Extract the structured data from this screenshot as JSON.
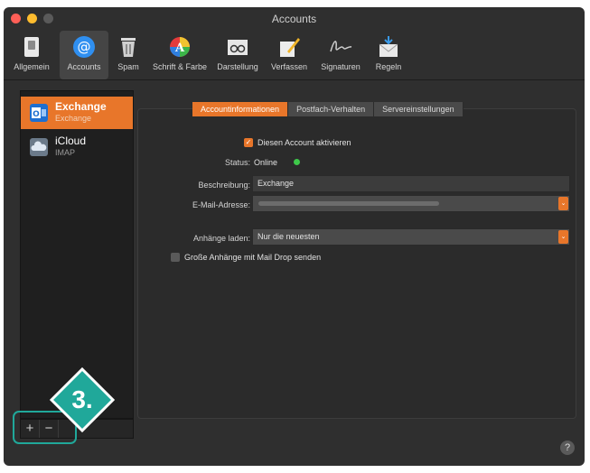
{
  "window": {
    "title": "Accounts"
  },
  "toolbar": {
    "items": [
      {
        "label": "Allgemein",
        "icon": "switch-icon"
      },
      {
        "label": "Accounts",
        "icon": "at-icon"
      },
      {
        "label": "Spam",
        "icon": "trash-icon"
      },
      {
        "label": "Schrift & Farbe",
        "icon": "color-wheel-icon"
      },
      {
        "label": "Darstellung",
        "icon": "glasses-icon"
      },
      {
        "label": "Verfassen",
        "icon": "pencil-icon"
      },
      {
        "label": "Signaturen",
        "icon": "signature-icon"
      },
      {
        "label": "Regeln",
        "icon": "rules-icon"
      }
    ]
  },
  "accounts": [
    {
      "name": "Exchange",
      "type": "Exchange",
      "icon": "outlook-icon"
    },
    {
      "name": "iCloud",
      "type": "IMAP",
      "icon": "cloud-icon"
    }
  ],
  "list_buttons": {
    "add": "+",
    "remove": "−"
  },
  "tabs": [
    "Accountinformationen",
    "Postfach-Verhalten",
    "Servereinstellungen"
  ],
  "form": {
    "enable_label": "Diesen Account aktivieren",
    "status_label": "Status:",
    "status_value": "Online",
    "description_label": "Beschreibung:",
    "description_value": "Exchange",
    "email_label": "E-Mail-Adresse:",
    "attachments_label": "Anhänge laden:",
    "attachments_value": "Nur die neuesten",
    "maildrop_label": "Große Anhänge mit Mail Drop senden"
  },
  "annotation": {
    "step": "3."
  },
  "help": "?",
  "colors": {
    "accent": "#e8762a",
    "status_online": "#3ec84a",
    "annotation": "#20a89a"
  }
}
